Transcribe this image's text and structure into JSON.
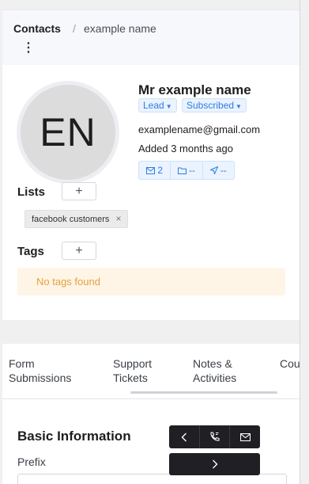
{
  "breadcrumb": {
    "root": "Contacts",
    "separator": "/",
    "current": "example name"
  },
  "header": {
    "more_icon": "vertical-dots-icon",
    "more_glyph": "⋮"
  },
  "contact": {
    "initials": "EN",
    "name": "Mr example name",
    "lifecycle": "Lead",
    "status": "Subscribed",
    "email": "examplename@gmail.com",
    "added": "Added 3 months ago"
  },
  "stats": [
    {
      "icon": "mail-icon",
      "value": "2"
    },
    {
      "icon": "folder-icon",
      "value": "--"
    },
    {
      "icon": "send-icon",
      "value": "--"
    }
  ],
  "lists": {
    "title": "Lists",
    "add_glyph": "+",
    "items": [
      "facebook customers"
    ],
    "remove_glyph": "×"
  },
  "tags": {
    "title": "Tags",
    "add_glyph": "+",
    "empty_text": "No tags found"
  },
  "tabs": [
    "Form Submissions",
    "Support Tickets",
    "Notes & Activities",
    "Cou"
  ],
  "basic_info": {
    "title": "Basic Information",
    "prefix_label": "Prefix",
    "prefix_value": ""
  },
  "floating_toolbar": {
    "buttons": [
      {
        "icon": "chevron-left-icon"
      },
      {
        "icon": "phone-icon"
      },
      {
        "icon": "mail-icon"
      }
    ],
    "next_icon": "chevron-right-icon"
  },
  "colors": {
    "accent": "#2e7ce4",
    "warning_text": "#e8a03a",
    "warning_bg": "#fef5e7",
    "toolbar_bg": "#1f1f24"
  }
}
